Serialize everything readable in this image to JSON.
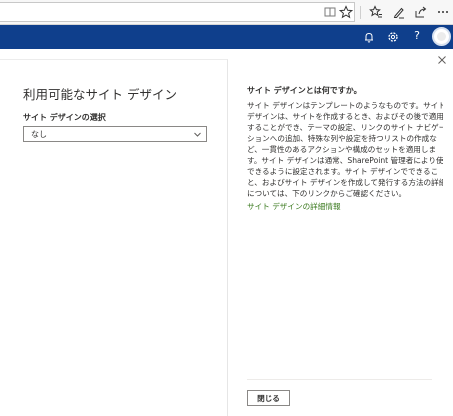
{
  "suite_bar": {
    "help_icon_label": "?"
  },
  "left_pane": {
    "title": "利用可能なサイト デザイン",
    "select_label": "サイト デザインの選択",
    "select_value": "なし"
  },
  "right_pane": {
    "title": "サイト デザインとは何ですか。",
    "body_lines": [
      "サイト デザインはテンプレートのようなものです。サイト",
      "デザインは、サイトを作成するとき、およびその後で適用",
      "することができ、テーマの設定、リンクのサイト ナビゲー",
      "ションへの追加、特殊な列や設定を持つリストの作成な",
      "ど、一貫性のあるアクションや構成のセットを適用しま",
      "す。サイト デザインは通常、SharePoint 管理者により使用",
      "できるように設定されます。サイト デザインでできるこ",
      "と、およびサイト デザインを作成して発行する方法の詳細",
      "については、下のリンクからご確認ください。"
    ],
    "link_text": "サイト デザインの詳細情報",
    "close_button_label": "閉じる"
  },
  "colors": {
    "suite_bar": "#0f3f8c",
    "link": "#3b7a1f",
    "text": "#323130"
  }
}
